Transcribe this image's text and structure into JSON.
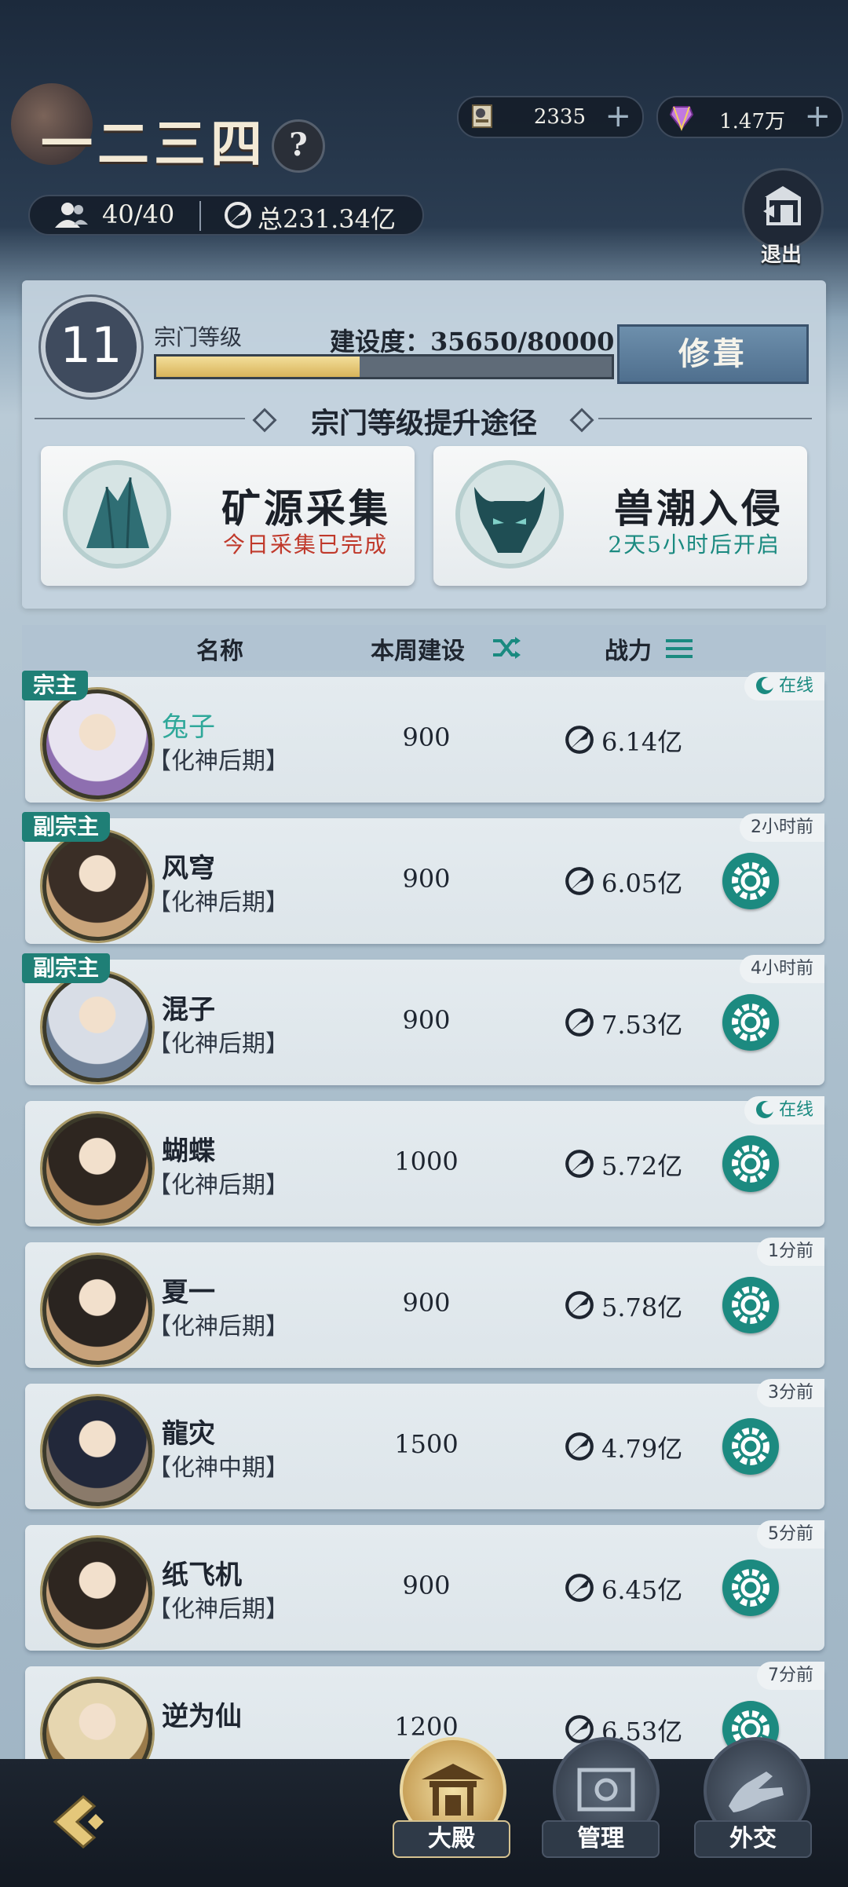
{
  "header": {
    "sect_name": "一二三四",
    "help_label": "?",
    "currency1": {
      "value": "2335",
      "plus": "+"
    },
    "currency2": {
      "value": "1.47万",
      "plus": "+"
    },
    "members": "40/40",
    "total_power": "总231.34亿",
    "exit_label": "退出"
  },
  "level_panel": {
    "level": "11",
    "level_title": "宗门等级",
    "build_progress_text": "建设度：35650/80000",
    "build_progress_fraction": 0.446,
    "repair_label": "修葺",
    "path_title": "宗门等级提升途径",
    "cards": [
      {
        "title": "矿源采集",
        "subtitle": "今日采集已完成",
        "subtitle_color": "#c0392b"
      },
      {
        "title": "兽潮入侵",
        "subtitle": "2天5小时后开启",
        "subtitle_color": "#1a8a80"
      }
    ]
  },
  "table": {
    "headers": {
      "name": "名称",
      "weekly_build": "本周建设",
      "power": "战力"
    },
    "rows": [
      {
        "role": "宗主",
        "name": "兔子",
        "rank": "【化神后期】",
        "build": "900",
        "power": "6.14亿",
        "status": "在线",
        "online": true,
        "self": true
      },
      {
        "role": "副宗主",
        "name": "风穹",
        "rank": "【化神后期】",
        "build": "900",
        "power": "6.05亿",
        "status": "2小时前",
        "online": false,
        "self": false
      },
      {
        "role": "副宗主",
        "name": "混子",
        "rank": "【化神后期】",
        "build": "900",
        "power": "7.53亿",
        "status": "4小时前",
        "online": false,
        "self": false
      },
      {
        "role": "",
        "name": "蝴蝶",
        "rank": "【化神后期】",
        "build": "1000",
        "power": "5.72亿",
        "status": "在线",
        "online": true,
        "self": false
      },
      {
        "role": "",
        "name": "夏一",
        "rank": "【化神后期】",
        "build": "900",
        "power": "5.78亿",
        "status": "1分前",
        "online": false,
        "self": false
      },
      {
        "role": "",
        "name": "龍灾",
        "rank": "【化神中期】",
        "build": "1500",
        "power": "4.79亿",
        "status": "3分前",
        "online": false,
        "self": false
      },
      {
        "role": "",
        "name": "纸飞机",
        "rank": "【化神后期】",
        "build": "900",
        "power": "6.45亿",
        "status": "5分前",
        "online": false,
        "self": false
      },
      {
        "role": "",
        "name": "逆为仙",
        "rank": "",
        "build": "1200",
        "power": "6.53亿",
        "status": "7分前",
        "online": false,
        "self": false
      }
    ]
  },
  "bottom_nav": {
    "tabs": [
      {
        "label": "大殿",
        "icon": "hall-icon",
        "active": true
      },
      {
        "label": "管理",
        "icon": "manage-icon",
        "active": false
      },
      {
        "label": "外交",
        "icon": "diplomacy-icon",
        "active": false
      }
    ]
  },
  "colors": {
    "accent_teal": "#1a8a80",
    "alert_red": "#c0392b",
    "gold": "#d8b45a"
  }
}
